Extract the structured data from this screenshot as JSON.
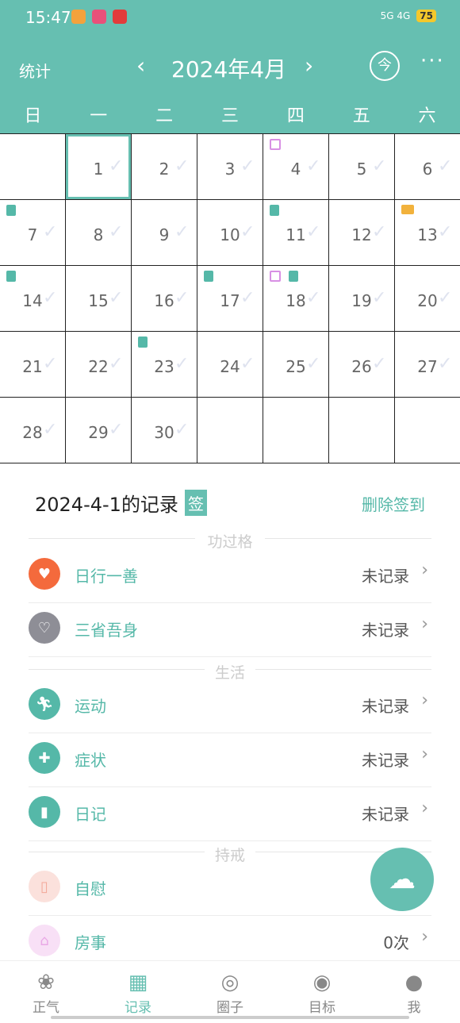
{
  "status": {
    "time": "15:47",
    "network": "5G 4G",
    "battery": "75"
  },
  "header": {
    "stats_label": "统计",
    "month_title": "2024年4月",
    "prev_glyph": "‹",
    "next_glyph": "›",
    "today_label": "今",
    "more_glyph": "···",
    "accent_color": "#66bfb1"
  },
  "weekdays": [
    "日",
    "一",
    "二",
    "三",
    "四",
    "五",
    "六"
  ],
  "calendar": {
    "days": [
      {
        "n": "",
        "marks": []
      },
      {
        "n": "1",
        "marks": [],
        "selected": true
      },
      {
        "n": "2",
        "marks": []
      },
      {
        "n": "3",
        "marks": []
      },
      {
        "n": "4",
        "marks": [
          "bed"
        ]
      },
      {
        "n": "5",
        "marks": []
      },
      {
        "n": "6",
        "marks": []
      },
      {
        "n": "7",
        "marks": [
          "book"
        ]
      },
      {
        "n": "8",
        "marks": []
      },
      {
        "n": "9",
        "marks": []
      },
      {
        "n": "10",
        "marks": []
      },
      {
        "n": "11",
        "marks": [
          "book"
        ]
      },
      {
        "n": "12",
        "marks": []
      },
      {
        "n": "13",
        "marks": [
          "screen"
        ]
      },
      {
        "n": "14",
        "marks": [
          "book"
        ]
      },
      {
        "n": "15",
        "marks": []
      },
      {
        "n": "16",
        "marks": []
      },
      {
        "n": "17",
        "marks": [
          "book"
        ]
      },
      {
        "n": "18",
        "marks": [
          "bed",
          "book"
        ]
      },
      {
        "n": "19",
        "marks": []
      },
      {
        "n": "20",
        "marks": []
      },
      {
        "n": "21",
        "marks": []
      },
      {
        "n": "22",
        "marks": []
      },
      {
        "n": "23",
        "marks": [
          "book"
        ]
      },
      {
        "n": "24",
        "marks": []
      },
      {
        "n": "25",
        "marks": []
      },
      {
        "n": "26",
        "marks": []
      },
      {
        "n": "27",
        "marks": []
      },
      {
        "n": "28",
        "marks": []
      },
      {
        "n": "29",
        "marks": []
      },
      {
        "n": "30",
        "marks": []
      },
      {
        "n": "",
        "marks": []
      },
      {
        "n": "",
        "marks": []
      },
      {
        "n": "",
        "marks": []
      },
      {
        "n": "",
        "marks": []
      }
    ]
  },
  "records": {
    "title": "2024-4-1的记录",
    "sign_label": "签",
    "delete_label": "删除签到",
    "sections": [
      {
        "label": "功过格"
      },
      {
        "label": "生活"
      },
      {
        "label": "持戒"
      }
    ],
    "items": [
      {
        "name": "日行一善",
        "value": "未记录",
        "icon": "heart-icon",
        "color": "#f46a3c"
      },
      {
        "name": "三省吾身",
        "value": "未记录",
        "icon": "broken-heart-icon",
        "color": "#8e8e96"
      },
      {
        "name": "运动",
        "value": "未记录",
        "icon": "running-icon",
        "color": "#55b8a8"
      },
      {
        "name": "症状",
        "value": "未记录",
        "icon": "medkit-icon",
        "color": "#55b8a8"
      },
      {
        "name": "日记",
        "value": "未记录",
        "icon": "diary-icon",
        "color": "#55b8a8"
      },
      {
        "name": "自慰",
        "value": "",
        "icon": "cup-icon",
        "color": "#fbe1dc"
      },
      {
        "name": "房事",
        "value": "0次",
        "icon": "house-icon",
        "color": "#f8e0f6"
      }
    ]
  },
  "nav": [
    {
      "label": "正气",
      "icon": "lotus-icon"
    },
    {
      "label": "记录",
      "icon": "calendar-icon",
      "active": true
    },
    {
      "label": "圈子",
      "icon": "circle-icon"
    },
    {
      "label": "目标",
      "icon": "target-icon"
    },
    {
      "label": "我",
      "icon": "user-icon"
    }
  ]
}
